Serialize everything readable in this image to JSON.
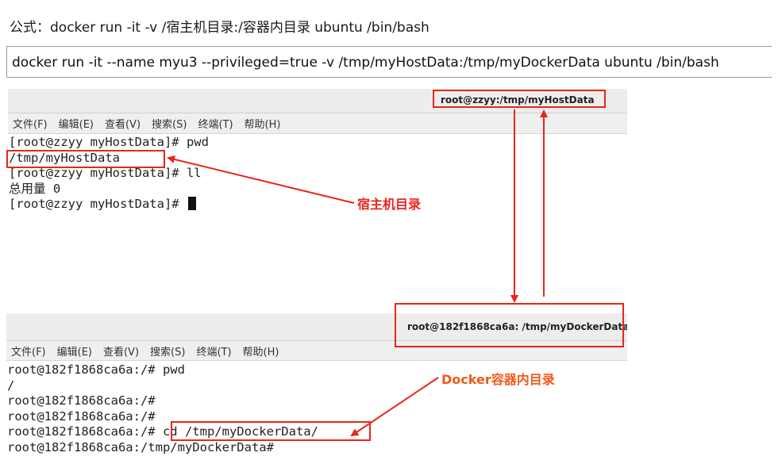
{
  "formula": "公式：docker run -it -v /宿主机目录:/容器内目录 ubuntu /bin/bash",
  "command": "docker run -it --name myu3 --privileged=true -v /tmp/myHostData:/tmp/myDockerData ubuntu /bin/bash",
  "host_terminal": {
    "title": "root@zzyy:/tmp/myHostData",
    "menu": [
      "文件(F)",
      "编辑(E)",
      "查看(V)",
      "搜索(S)",
      "终端(T)",
      "帮助(H)"
    ],
    "lines": [
      "[root@zzyy myHostData]# pwd",
      "/tmp/myHostData",
      "[root@zzyy myHostData]# ll",
      "总用量 0",
      "[root@zzyy myHostData]# "
    ]
  },
  "container_terminal": {
    "title": "root@182f1868ca6a: /tmp/myDockerData",
    "menu": [
      "文件(F)",
      "编辑(E)",
      "查看(V)",
      "搜索(S)",
      "终端(T)",
      "帮助(H)"
    ],
    "lines": [
      "root@182f1868ca6a:/# pwd",
      "/",
      "root@182f1868ca6a:/#",
      "root@182f1868ca6a:/#",
      "root@182f1868ca6a:/# cd /tmp/myDockerData/",
      "root@182f1868ca6a:/tmp/myDockerData#"
    ]
  },
  "annotations": {
    "host_dir": "宿主机目录",
    "container_dir": "Docker容器内目录"
  },
  "colors": {
    "annotation_red": "#e8261b",
    "annotation_orange": "#f05a1a"
  }
}
